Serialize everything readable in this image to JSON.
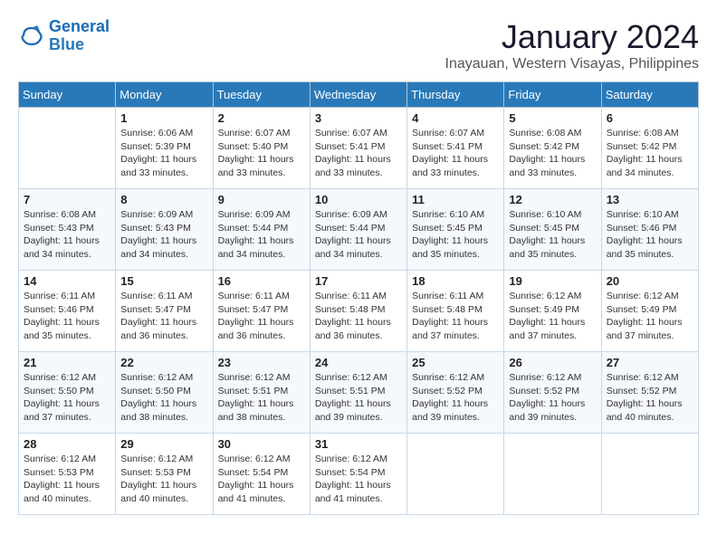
{
  "header": {
    "logo_line1": "General",
    "logo_line2": "Blue",
    "month": "January 2024",
    "location": "Inayauan, Western Visayas, Philippines"
  },
  "days_of_week": [
    "Sunday",
    "Monday",
    "Tuesday",
    "Wednesday",
    "Thursday",
    "Friday",
    "Saturday"
  ],
  "weeks": [
    [
      {
        "day": "",
        "info": ""
      },
      {
        "day": "1",
        "info": "Sunrise: 6:06 AM\nSunset: 5:39 PM\nDaylight: 11 hours\nand 33 minutes."
      },
      {
        "day": "2",
        "info": "Sunrise: 6:07 AM\nSunset: 5:40 PM\nDaylight: 11 hours\nand 33 minutes."
      },
      {
        "day": "3",
        "info": "Sunrise: 6:07 AM\nSunset: 5:41 PM\nDaylight: 11 hours\nand 33 minutes."
      },
      {
        "day": "4",
        "info": "Sunrise: 6:07 AM\nSunset: 5:41 PM\nDaylight: 11 hours\nand 33 minutes."
      },
      {
        "day": "5",
        "info": "Sunrise: 6:08 AM\nSunset: 5:42 PM\nDaylight: 11 hours\nand 33 minutes."
      },
      {
        "day": "6",
        "info": "Sunrise: 6:08 AM\nSunset: 5:42 PM\nDaylight: 11 hours\nand 34 minutes."
      }
    ],
    [
      {
        "day": "7",
        "info": "Sunrise: 6:08 AM\nSunset: 5:43 PM\nDaylight: 11 hours\nand 34 minutes."
      },
      {
        "day": "8",
        "info": "Sunrise: 6:09 AM\nSunset: 5:43 PM\nDaylight: 11 hours\nand 34 minutes."
      },
      {
        "day": "9",
        "info": "Sunrise: 6:09 AM\nSunset: 5:44 PM\nDaylight: 11 hours\nand 34 minutes."
      },
      {
        "day": "10",
        "info": "Sunrise: 6:09 AM\nSunset: 5:44 PM\nDaylight: 11 hours\nand 34 minutes."
      },
      {
        "day": "11",
        "info": "Sunrise: 6:10 AM\nSunset: 5:45 PM\nDaylight: 11 hours\nand 35 minutes."
      },
      {
        "day": "12",
        "info": "Sunrise: 6:10 AM\nSunset: 5:45 PM\nDaylight: 11 hours\nand 35 minutes."
      },
      {
        "day": "13",
        "info": "Sunrise: 6:10 AM\nSunset: 5:46 PM\nDaylight: 11 hours\nand 35 minutes."
      }
    ],
    [
      {
        "day": "14",
        "info": "Sunrise: 6:11 AM\nSunset: 5:46 PM\nDaylight: 11 hours\nand 35 minutes."
      },
      {
        "day": "15",
        "info": "Sunrise: 6:11 AM\nSunset: 5:47 PM\nDaylight: 11 hours\nand 36 minutes."
      },
      {
        "day": "16",
        "info": "Sunrise: 6:11 AM\nSunset: 5:47 PM\nDaylight: 11 hours\nand 36 minutes."
      },
      {
        "day": "17",
        "info": "Sunrise: 6:11 AM\nSunset: 5:48 PM\nDaylight: 11 hours\nand 36 minutes."
      },
      {
        "day": "18",
        "info": "Sunrise: 6:11 AM\nSunset: 5:48 PM\nDaylight: 11 hours\nand 37 minutes."
      },
      {
        "day": "19",
        "info": "Sunrise: 6:12 AM\nSunset: 5:49 PM\nDaylight: 11 hours\nand 37 minutes."
      },
      {
        "day": "20",
        "info": "Sunrise: 6:12 AM\nSunset: 5:49 PM\nDaylight: 11 hours\nand 37 minutes."
      }
    ],
    [
      {
        "day": "21",
        "info": "Sunrise: 6:12 AM\nSunset: 5:50 PM\nDaylight: 11 hours\nand 37 minutes."
      },
      {
        "day": "22",
        "info": "Sunrise: 6:12 AM\nSunset: 5:50 PM\nDaylight: 11 hours\nand 38 minutes."
      },
      {
        "day": "23",
        "info": "Sunrise: 6:12 AM\nSunset: 5:51 PM\nDaylight: 11 hours\nand 38 minutes."
      },
      {
        "day": "24",
        "info": "Sunrise: 6:12 AM\nSunset: 5:51 PM\nDaylight: 11 hours\nand 39 minutes."
      },
      {
        "day": "25",
        "info": "Sunrise: 6:12 AM\nSunset: 5:52 PM\nDaylight: 11 hours\nand 39 minutes."
      },
      {
        "day": "26",
        "info": "Sunrise: 6:12 AM\nSunset: 5:52 PM\nDaylight: 11 hours\nand 39 minutes."
      },
      {
        "day": "27",
        "info": "Sunrise: 6:12 AM\nSunset: 5:52 PM\nDaylight: 11 hours\nand 40 minutes."
      }
    ],
    [
      {
        "day": "28",
        "info": "Sunrise: 6:12 AM\nSunset: 5:53 PM\nDaylight: 11 hours\nand 40 minutes."
      },
      {
        "day": "29",
        "info": "Sunrise: 6:12 AM\nSunset: 5:53 PM\nDaylight: 11 hours\nand 40 minutes."
      },
      {
        "day": "30",
        "info": "Sunrise: 6:12 AM\nSunset: 5:54 PM\nDaylight: 11 hours\nand 41 minutes."
      },
      {
        "day": "31",
        "info": "Sunrise: 6:12 AM\nSunset: 5:54 PM\nDaylight: 11 hours\nand 41 minutes."
      },
      {
        "day": "",
        "info": ""
      },
      {
        "day": "",
        "info": ""
      },
      {
        "day": "",
        "info": ""
      }
    ]
  ]
}
